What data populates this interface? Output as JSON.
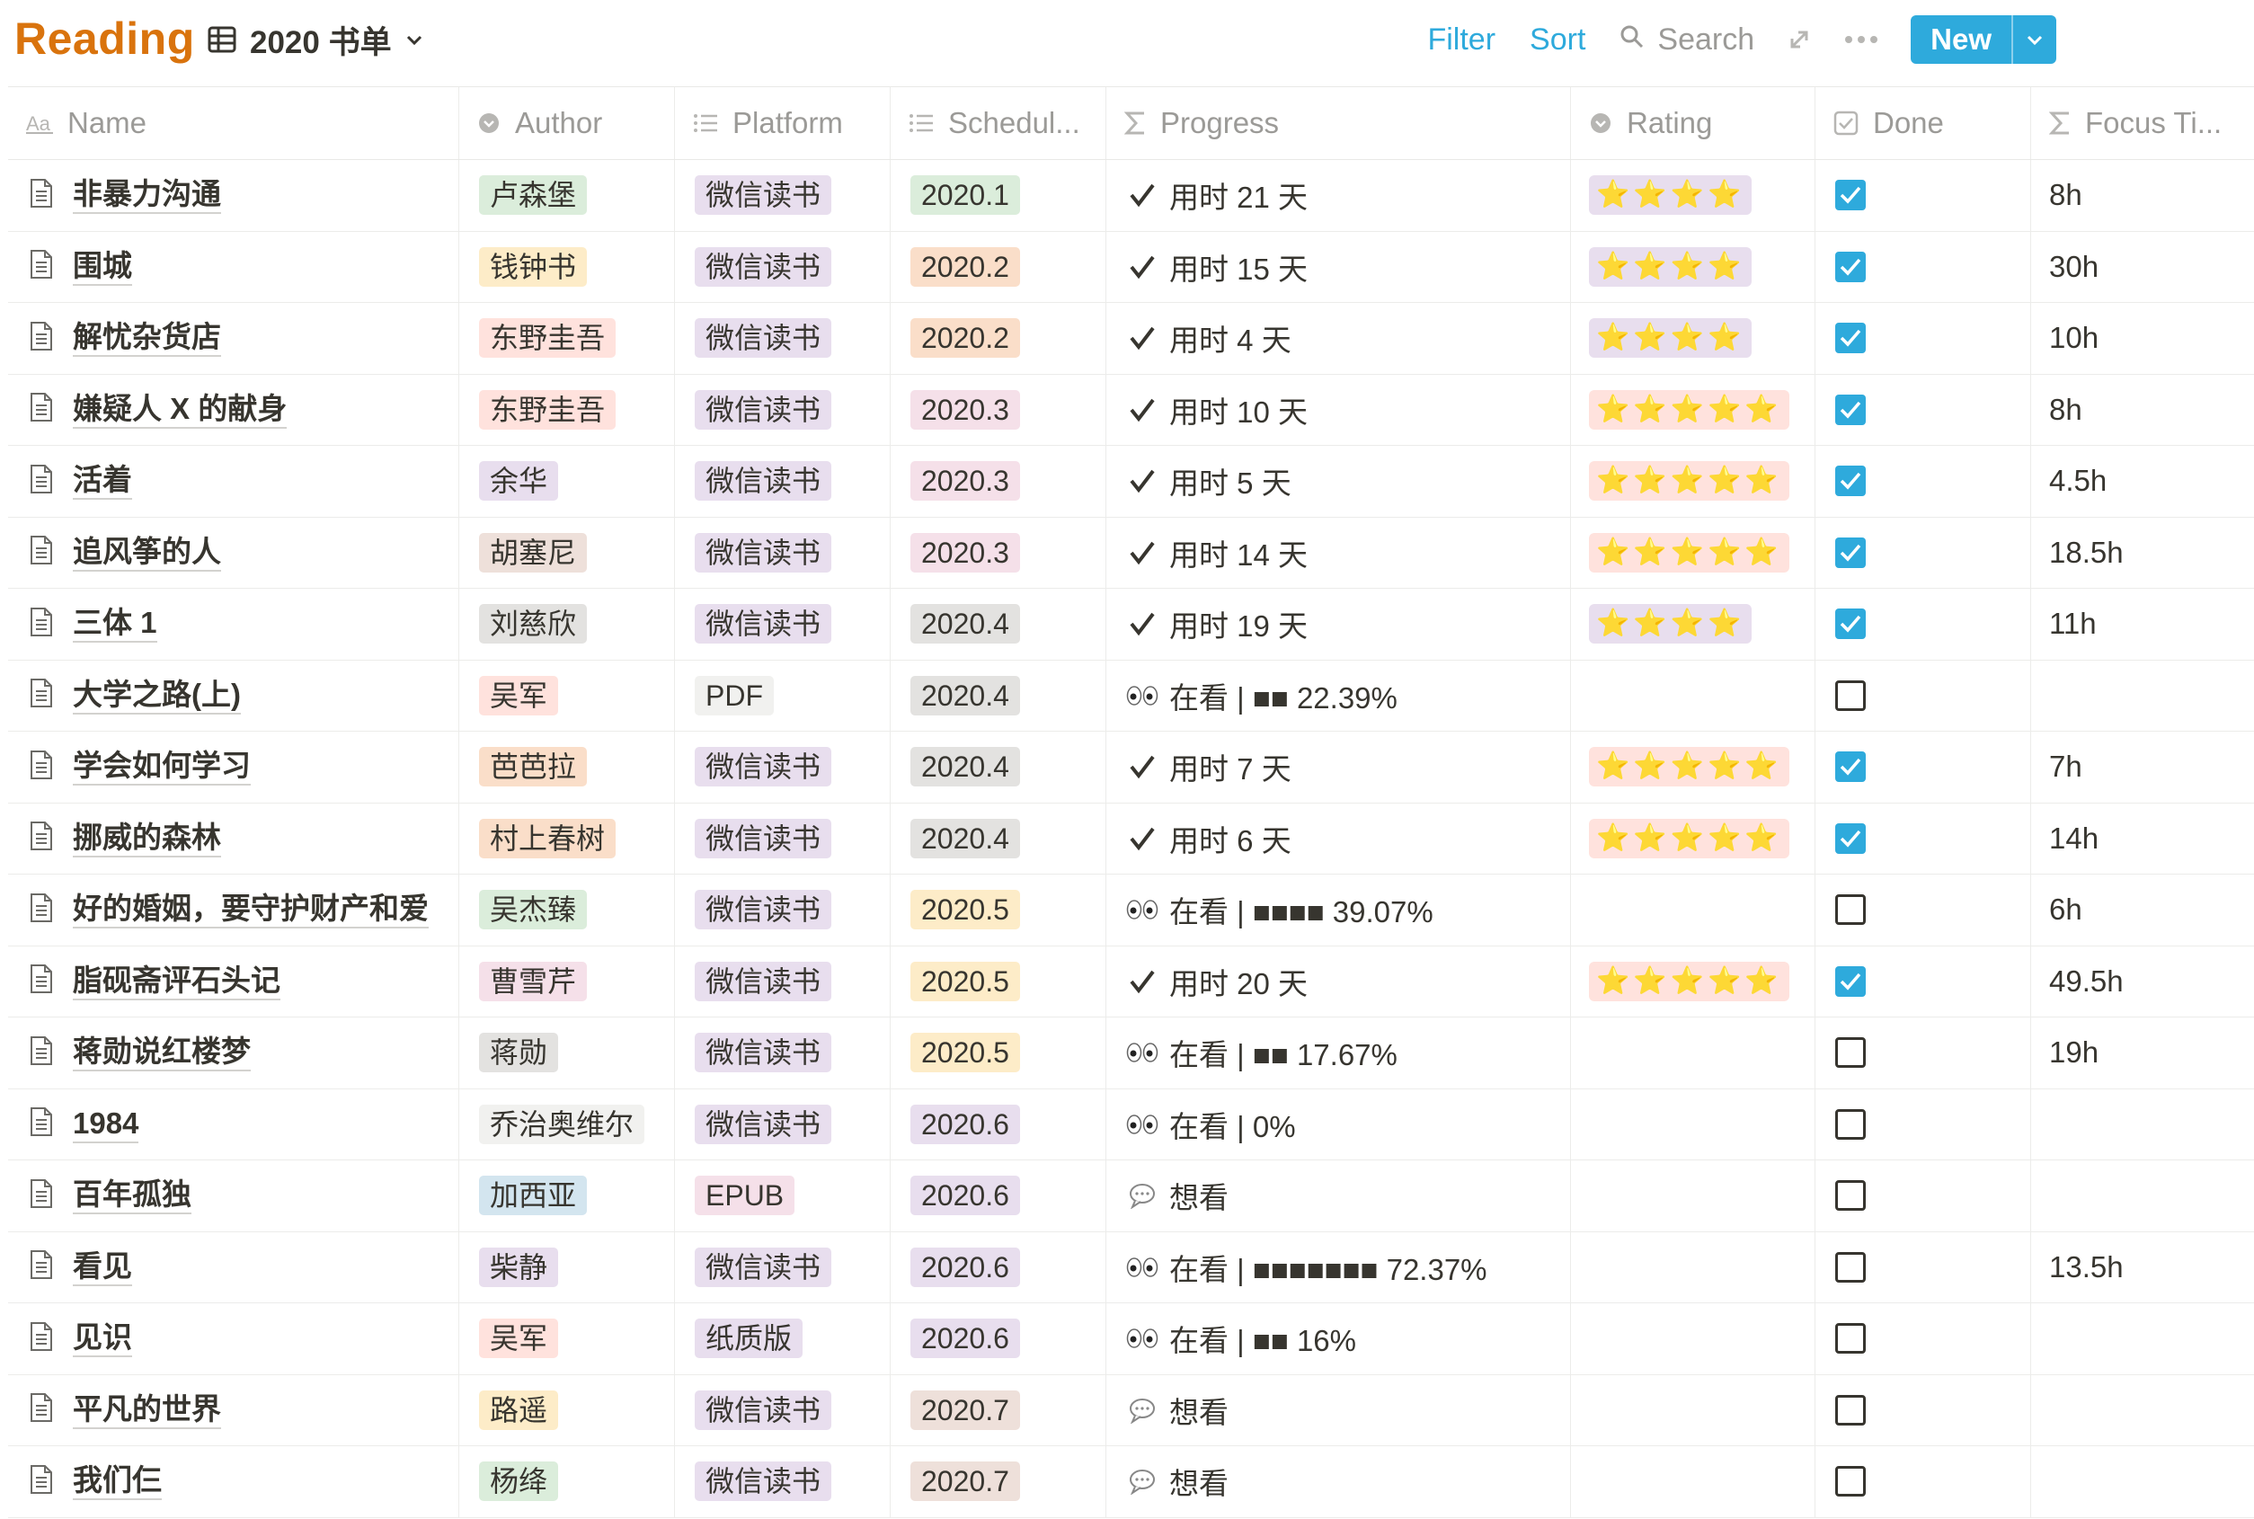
{
  "app": {
    "title": "Reading"
  },
  "view": {
    "name": "2020 书单"
  },
  "toolbar": {
    "filter": "Filter",
    "sort": "Sort",
    "search": "Search",
    "new": "New"
  },
  "colors": {
    "accent": "#2eaadc",
    "title": "#d9730d",
    "tag_green": "#dbeddb",
    "tag_yellow": "#fdecc8",
    "tag_red": "#ffe2dd",
    "tag_purple": "#e8deee",
    "tag_brown": "#eee0da",
    "tag_gray": "#e3e2e0",
    "tag_orange": "#fadec9",
    "tag_pink": "#f5e0e9",
    "tag_blue": "#d3e5ef",
    "tag_light": "#f1f1ef",
    "rating_purple": "#e8deee",
    "rating_red": "#ffe2dd"
  },
  "columns": [
    {
      "label": "Name",
      "icon": "text-aa-icon"
    },
    {
      "label": "Author",
      "icon": "select-icon"
    },
    {
      "label": "Platform",
      "icon": "multi-select-icon"
    },
    {
      "label": "Schedul...",
      "icon": "multi-select-icon"
    },
    {
      "label": "Progress",
      "icon": "formula-sigma-icon"
    },
    {
      "label": "Rating",
      "icon": "select-icon"
    },
    {
      "label": "Done",
      "icon": "checkbox-icon"
    },
    {
      "label": "Focus Ti...",
      "icon": "formula-sigma-icon"
    }
  ],
  "rows": [
    {
      "name": "非暴力沟通",
      "author": "卢森堡",
      "author_color": "green",
      "platform": "微信读书",
      "platform_color": "purple",
      "schedule": "2020.1",
      "schedule_color": "green",
      "progress_icon": "check",
      "progress": "用时 21 天",
      "rating": "⭐⭐⭐⭐",
      "rating_color": "purple",
      "done": true,
      "focus": "8h"
    },
    {
      "name": "围城",
      "author": "钱钟书",
      "author_color": "yellow",
      "platform": "微信读书",
      "platform_color": "purple",
      "schedule": "2020.2",
      "schedule_color": "orange",
      "progress_icon": "check",
      "progress": "用时 15 天",
      "rating": "⭐⭐⭐⭐",
      "rating_color": "purple",
      "done": true,
      "focus": "30h"
    },
    {
      "name": "解忧杂货店",
      "author": "东野圭吾",
      "author_color": "red",
      "platform": "微信读书",
      "platform_color": "purple",
      "schedule": "2020.2",
      "schedule_color": "orange",
      "progress_icon": "check",
      "progress": "用时 4 天",
      "rating": "⭐⭐⭐⭐",
      "rating_color": "purple",
      "done": true,
      "focus": "10h"
    },
    {
      "name": "嫌疑人 X 的献身",
      "author": "东野圭吾",
      "author_color": "red",
      "platform": "微信读书",
      "platform_color": "purple",
      "schedule": "2020.3",
      "schedule_color": "pink",
      "progress_icon": "check",
      "progress": "用时 10 天",
      "rating": "⭐⭐⭐⭐⭐",
      "rating_color": "red",
      "done": true,
      "focus": "8h"
    },
    {
      "name": "活着",
      "author": "余华",
      "author_color": "purple",
      "platform": "微信读书",
      "platform_color": "purple",
      "schedule": "2020.3",
      "schedule_color": "pink",
      "progress_icon": "check",
      "progress": "用时 5 天",
      "rating": "⭐⭐⭐⭐⭐",
      "rating_color": "red",
      "done": true,
      "focus": "4.5h"
    },
    {
      "name": "追风筝的人",
      "author": "胡塞尼",
      "author_color": "brown",
      "platform": "微信读书",
      "platform_color": "purple",
      "schedule": "2020.3",
      "schedule_color": "pink",
      "progress_icon": "check",
      "progress": "用时 14 天",
      "rating": "⭐⭐⭐⭐⭐",
      "rating_color": "red",
      "done": true,
      "focus": "18.5h"
    },
    {
      "name": "三体 1",
      "author": "刘慈欣",
      "author_color": "gray",
      "platform": "微信读书",
      "platform_color": "purple",
      "schedule": "2020.4",
      "schedule_color": "gray",
      "progress_icon": "check",
      "progress": "用时 19 天",
      "rating": "⭐⭐⭐⭐",
      "rating_color": "purple",
      "done": true,
      "focus": "11h"
    },
    {
      "name": "大学之路(上)",
      "author": "吴军",
      "author_color": "red",
      "platform": "PDF",
      "platform_color": "light",
      "schedule": "2020.4",
      "schedule_color": "gray",
      "progress_icon": "eyes",
      "progress": "在看 | ■■ 22.39%",
      "rating": "",
      "rating_color": "",
      "done": false,
      "focus": ""
    },
    {
      "name": "学会如何学习",
      "author": "芭芭拉",
      "author_color": "orange",
      "platform": "微信读书",
      "platform_color": "purple",
      "schedule": "2020.4",
      "schedule_color": "gray",
      "progress_icon": "check",
      "progress": "用时 7 天",
      "rating": "⭐⭐⭐⭐⭐",
      "rating_color": "red",
      "done": true,
      "focus": "7h"
    },
    {
      "name": "挪威的森林",
      "author": "村上春树",
      "author_color": "orange",
      "platform": "微信读书",
      "platform_color": "purple",
      "schedule": "2020.4",
      "schedule_color": "gray",
      "progress_icon": "check",
      "progress": "用时 6 天",
      "rating": "⭐⭐⭐⭐⭐",
      "rating_color": "red",
      "done": true,
      "focus": "14h"
    },
    {
      "name": "好的婚姻，要守护财产和爱",
      "author": "吴杰臻",
      "author_color": "green",
      "platform": "微信读书",
      "platform_color": "purple",
      "schedule": "2020.5",
      "schedule_color": "yellow",
      "progress_icon": "eyes",
      "progress": "在看 | ■■■■ 39.07%",
      "rating": "",
      "rating_color": "",
      "done": false,
      "focus": "6h"
    },
    {
      "name": "脂砚斋评石头记",
      "author": "曹雪芹",
      "author_color": "pink",
      "platform": "微信读书",
      "platform_color": "purple",
      "schedule": "2020.5",
      "schedule_color": "yellow",
      "progress_icon": "check",
      "progress": "用时 20 天",
      "rating": "⭐⭐⭐⭐⭐",
      "rating_color": "red",
      "done": true,
      "focus": "49.5h"
    },
    {
      "name": "蒋勋说红楼梦",
      "author": "蒋勋",
      "author_color": "gray",
      "platform": "微信读书",
      "platform_color": "purple",
      "schedule": "2020.5",
      "schedule_color": "yellow",
      "progress_icon": "eyes",
      "progress": "在看 | ■■ 17.67%",
      "rating": "",
      "rating_color": "",
      "done": false,
      "focus": "19h"
    },
    {
      "name": "1984",
      "author": "乔治奥维尔",
      "author_color": "light",
      "platform": "微信读书",
      "platform_color": "purple",
      "schedule": "2020.6",
      "schedule_color": "purple",
      "progress_icon": "eyes",
      "progress": "在看 | 0%",
      "rating": "",
      "rating_color": "",
      "done": false,
      "focus": ""
    },
    {
      "name": "百年孤独",
      "author": "加西亚",
      "author_color": "blue",
      "platform": "EPUB",
      "platform_color": "pink",
      "schedule": "2020.6",
      "schedule_color": "purple",
      "progress_icon": "speech",
      "progress": "想看",
      "rating": "",
      "rating_color": "",
      "done": false,
      "focus": ""
    },
    {
      "name": "看见",
      "author": "柴静",
      "author_color": "purple",
      "platform": "微信读书",
      "platform_color": "purple",
      "schedule": "2020.6",
      "schedule_color": "purple",
      "progress_icon": "eyes",
      "progress": "在看 | ■■■■■■■ 72.37%",
      "rating": "",
      "rating_color": "",
      "done": false,
      "focus": "13.5h"
    },
    {
      "name": "见识",
      "author": "吴军",
      "author_color": "red",
      "platform": "纸质版",
      "platform_color": "purple",
      "schedule": "2020.6",
      "schedule_color": "purple",
      "progress_icon": "eyes",
      "progress": "在看 | ■■ 16%",
      "rating": "",
      "rating_color": "",
      "done": false,
      "focus": ""
    },
    {
      "name": "平凡的世界",
      "author": "路遥",
      "author_color": "yellow",
      "platform": "微信读书",
      "platform_color": "purple",
      "schedule": "2020.7",
      "schedule_color": "brown",
      "progress_icon": "speech",
      "progress": "想看",
      "rating": "",
      "rating_color": "",
      "done": false,
      "focus": ""
    },
    {
      "name": "我们仨",
      "author": "杨绛",
      "author_color": "green",
      "platform": "微信读书",
      "platform_color": "purple",
      "schedule": "2020.7",
      "schedule_color": "brown",
      "progress_icon": "speech",
      "progress": "想看",
      "rating": "",
      "rating_color": "",
      "done": false,
      "focus": ""
    }
  ]
}
